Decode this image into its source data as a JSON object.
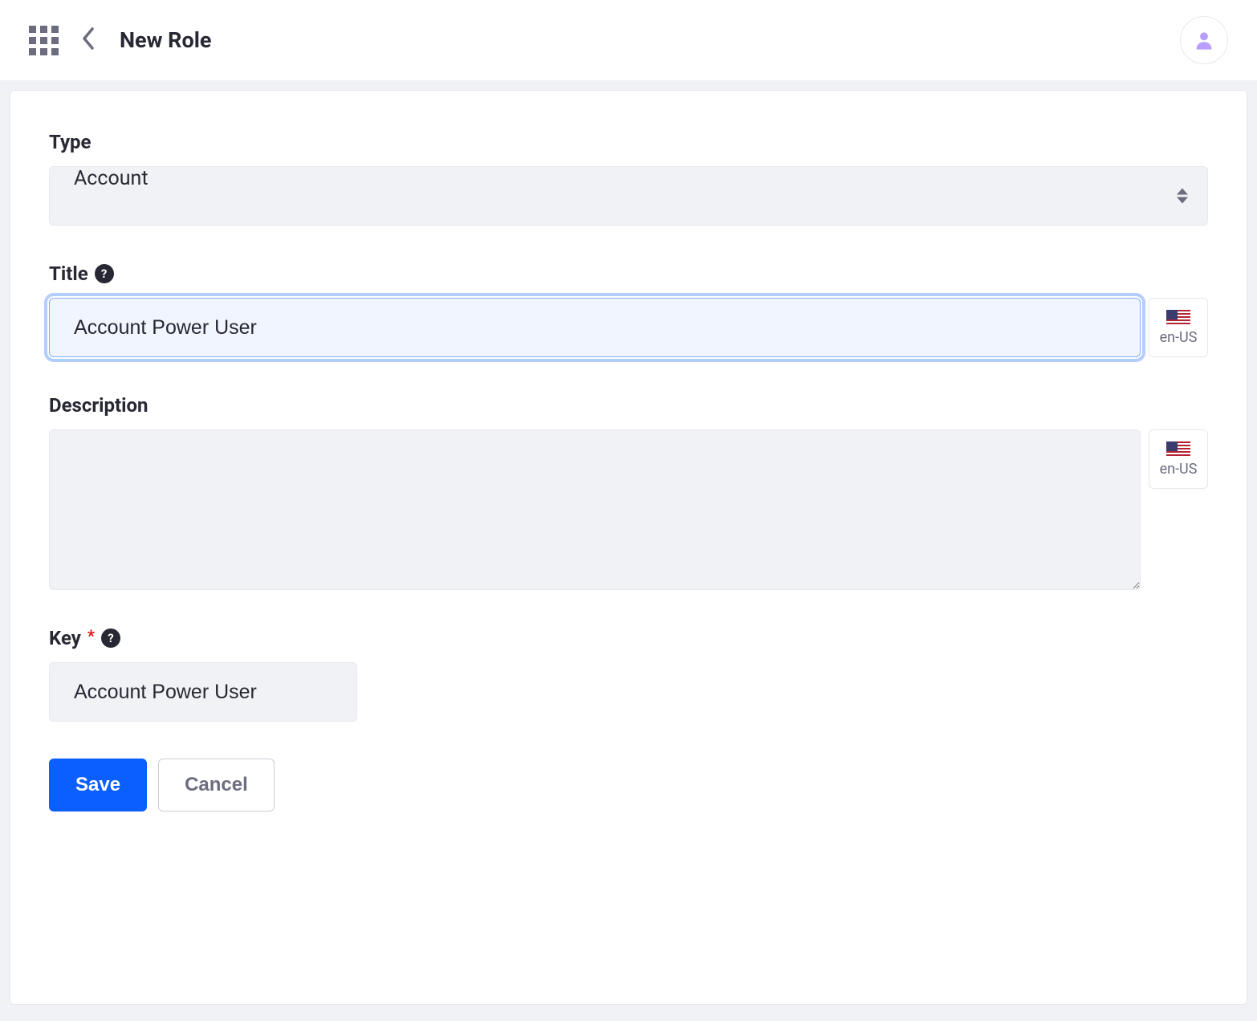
{
  "header": {
    "title": "New Role"
  },
  "form": {
    "type": {
      "label": "Type",
      "value": "Account"
    },
    "title": {
      "label": "Title",
      "value": "Account Power User",
      "locale": "en-US"
    },
    "description": {
      "label": "Description",
      "value": "",
      "locale": "en-US"
    },
    "key": {
      "label": "Key",
      "value": "Account Power User"
    }
  },
  "buttons": {
    "save": "Save",
    "cancel": "Cancel"
  }
}
